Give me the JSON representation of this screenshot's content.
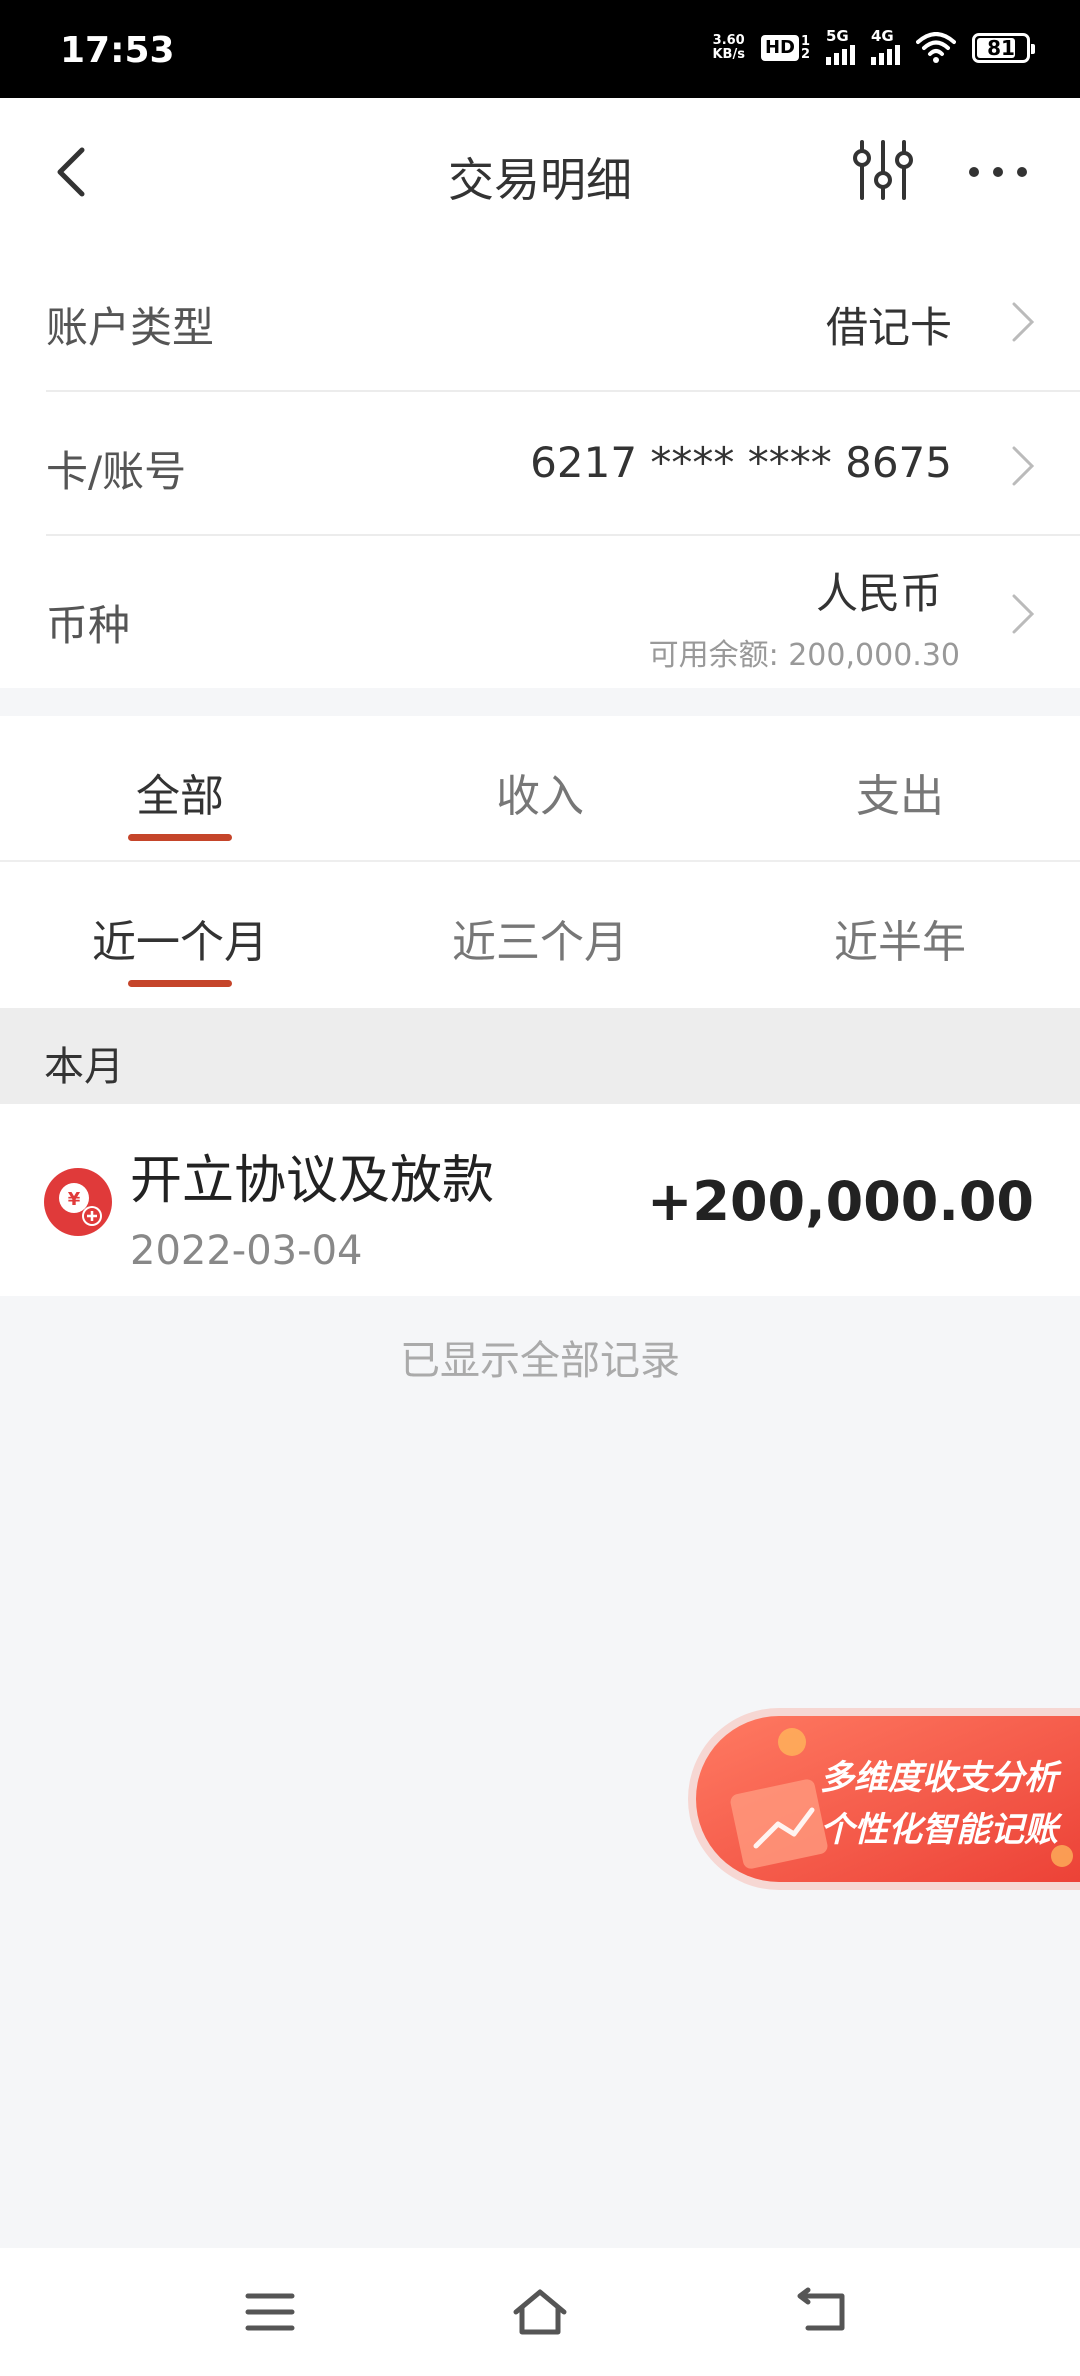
{
  "status_bar": {
    "time": "17:53",
    "net_speed_value": "3.60",
    "net_speed_unit": "KB/s",
    "hd_label": "HD",
    "hd_sup": "1",
    "hd_sub": "2",
    "sig1_label": "5G",
    "sig2_label": "4G",
    "battery": "81",
    "battery_level": 0.81
  },
  "header": {
    "title": "交易明细",
    "back_icon": "chevron-left-icon",
    "filter_icon": "sliders-icon",
    "more_icon": "more-horizontal-icon"
  },
  "account": {
    "type_label": "账户类型",
    "type_value": "借记卡",
    "card_label": "卡/账号",
    "card_value": "6217 **** **** 8675",
    "currency_label": "币种",
    "currency_value": "人民币",
    "balance_text": "可用余额: 200,000.30"
  },
  "type_tabs": [
    {
      "label": "全部",
      "active": true
    },
    {
      "label": "收入",
      "active": false
    },
    {
      "label": "支出",
      "active": false
    }
  ],
  "period_tabs": [
    {
      "label": "近一个月",
      "active": true
    },
    {
      "label": "近三个月",
      "active": false
    },
    {
      "label": "近半年",
      "active": false
    }
  ],
  "month_header": "本月",
  "transactions": [
    {
      "title": "开立协议及放款",
      "date": "2022-03-04",
      "amount": "+200,000.00",
      "icon": "yuan-plus-icon"
    }
  ],
  "all_shown_text": "已显示全部记录",
  "promo": {
    "line1": "多维度收支分析",
    "line2": "个性化智能记账"
  },
  "nav": {
    "menu_icon": "menu-icon",
    "home_icon": "home-icon",
    "back_icon": "back-icon"
  },
  "colors": {
    "accent": "#c5452a",
    "txn_icon_red": "#e03a3a",
    "promo_red": "#f0574a"
  }
}
